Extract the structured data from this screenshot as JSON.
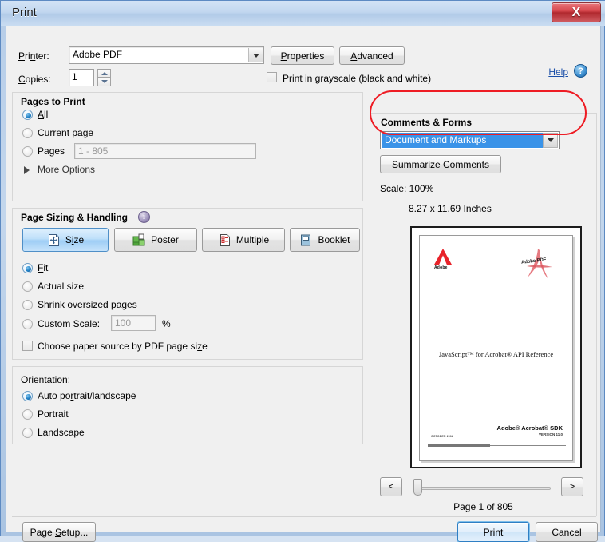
{
  "window": {
    "title": "Print",
    "close_label": "X",
    "close_icon": "close-icon"
  },
  "printer_row": {
    "printer_label": "Printer:",
    "printer_value": "Adobe PDF",
    "properties_label": "Properties",
    "advanced_label": "Advanced",
    "help_label": "Help",
    "help_icon": "question-mark-icon",
    "dropdown_icon": "chevron-down-icon"
  },
  "copies_row": {
    "copies_label": "Copies:",
    "copies_value": "1",
    "spinner_up_icon": "caret-up-icon",
    "spinner_down_icon": "caret-down-icon",
    "grayscale_label": "Print in grayscale (black and white)",
    "grayscale_checked": false
  },
  "pages_to_print": {
    "title": "Pages to Print",
    "options": [
      {
        "label": "All",
        "selected": true
      },
      {
        "label": "Current page",
        "selected": false
      },
      {
        "label": "Pages",
        "selected": false
      }
    ],
    "pages_placeholder": "1 - 805",
    "more_options_label": "More Options",
    "more_options_icon": "triangle-right-icon"
  },
  "page_sizing": {
    "title": "Page Sizing & Handling",
    "info_icon": "info-icon",
    "info_label": "i",
    "mode_buttons": [
      {
        "label": "Size",
        "icon": "resize-page-icon",
        "active": true
      },
      {
        "label": "Poster",
        "icon": "poster-tiles-icon",
        "active": false
      },
      {
        "label": "Multiple",
        "icon": "multiple-pages-icon",
        "active": false
      },
      {
        "label": "Booklet",
        "icon": "booklet-icon",
        "active": false
      }
    ],
    "scale_options": [
      {
        "label": "Fit",
        "selected": true
      },
      {
        "label": "Actual size",
        "selected": false
      },
      {
        "label": "Shrink oversized pages",
        "selected": false
      },
      {
        "label": "Custom Scale:",
        "selected": false
      }
    ],
    "custom_scale_value": "100",
    "percent_label": "%",
    "paper_source_label": "Choose paper source by PDF page size",
    "paper_source_checked": false
  },
  "orientation": {
    "title": "Orientation:",
    "options": [
      {
        "label": "Auto portrait/landscape",
        "selected": true
      },
      {
        "label": "Portrait",
        "selected": false
      },
      {
        "label": "Landscape",
        "selected": false
      }
    ]
  },
  "comments_forms": {
    "title": "Comments & Forms",
    "selected_value": "Document and Markups",
    "dropdown_icon": "chevron-down-icon",
    "summarize_label": "Summarize Comments",
    "highlight_color": "#ee1c24"
  },
  "preview": {
    "scale_label": "Scale: 100%",
    "dimensions_label": "8.27 x 11.69 Inches",
    "document": {
      "adobe_logo_text": "Adobe",
      "pdf_badge_text": "Adobe PDF",
      "title": "JavaScript™ for Acrobat® API Reference",
      "sdk_line": "Adobe® Acrobat® SDK",
      "version_line": "VERSION 11.0",
      "date_line": "OCTOBER 2012"
    },
    "prev_label": "<",
    "next_label": ">",
    "prev_icon": "chevron-left-icon",
    "next_icon": "chevron-right-icon",
    "page_info": "Page 1 of 805"
  },
  "footer": {
    "page_setup_label": "Page Setup...",
    "print_label": "Print",
    "cancel_label": "Cancel"
  }
}
